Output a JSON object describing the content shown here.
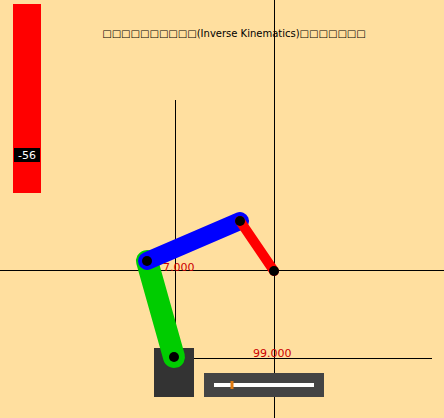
{
  "title": "□□□□□□□□□□(Inverse Kinematics)□□□□□□□",
  "meter": {
    "reading": "-56",
    "color": "#ff0000"
  },
  "axis_labels": {
    "y": "7.000",
    "x": "99.000"
  },
  "arm": {
    "links": [
      {
        "color": "#00cc00"
      },
      {
        "color": "#0000ff"
      },
      {
        "color": "#ff0000"
      }
    ]
  },
  "slider": {
    "level": 0.18
  }
}
